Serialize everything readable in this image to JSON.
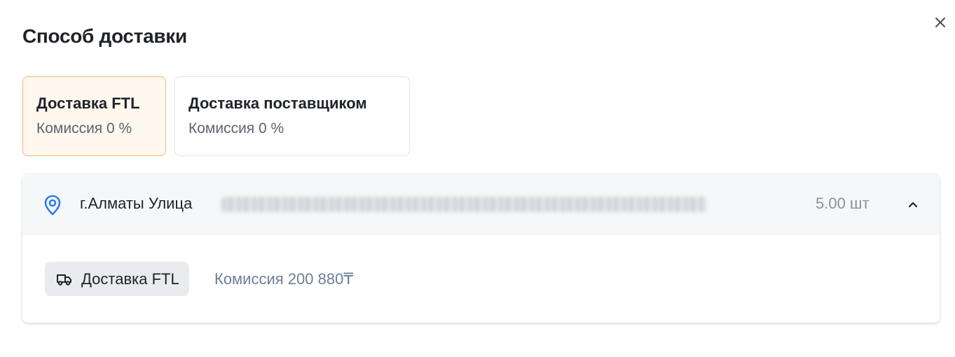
{
  "dialog": {
    "title": "Способ доставки",
    "close_icon": "close-icon"
  },
  "options": [
    {
      "name": "Доставка FTL",
      "fee": "Комиссия 0 %",
      "selected": true
    },
    {
      "name": "Доставка поставщиком",
      "fee": "Комиссия 0 %",
      "selected": false
    }
  ],
  "delivery_card": {
    "location_icon": "map-pin-icon",
    "address_prefix": "г.Алматы Улица",
    "quantity": "5.00 шт",
    "toggle_icon": "chevron-up-icon",
    "method_icon": "truck-icon",
    "method_label": "Доставка FTL",
    "commission": "Комиссия 200 880₸"
  },
  "colors": {
    "selected_border": "#f3b772",
    "selected_bg": "#fff8ef",
    "pin_blue": "#2f7cf6",
    "muted_text": "#6d7f93"
  }
}
